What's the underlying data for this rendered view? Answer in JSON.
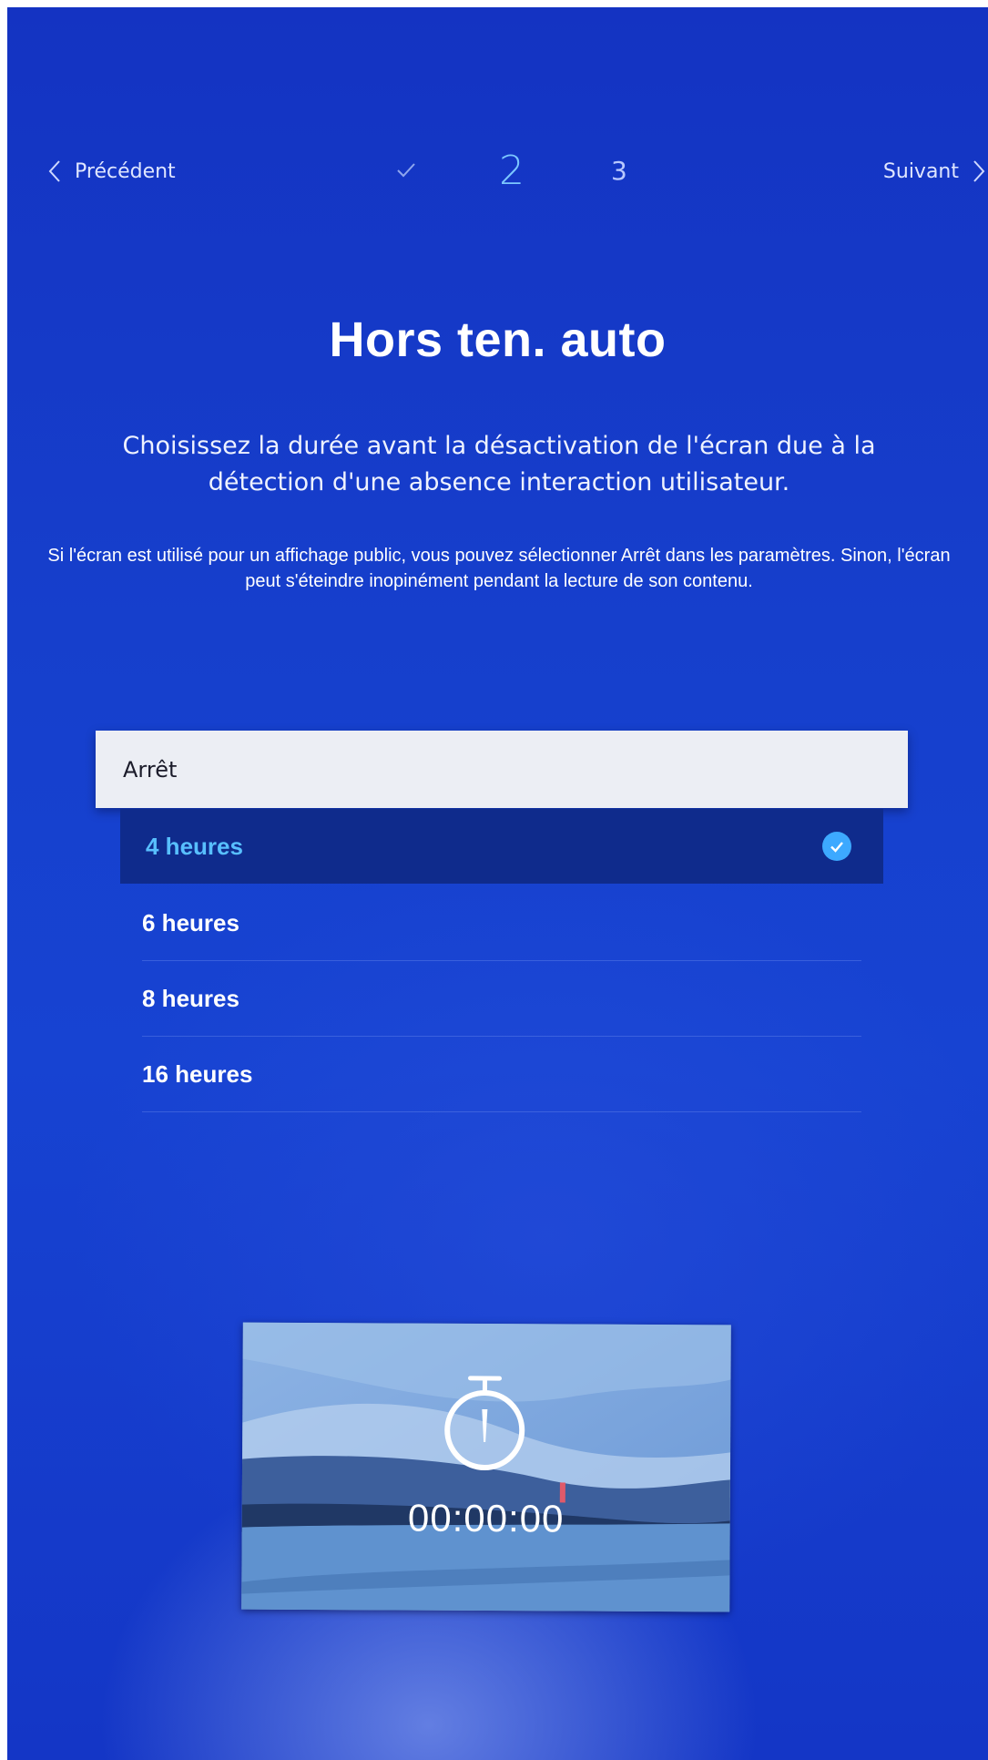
{
  "nav": {
    "previous_label": "Précédent",
    "next_label": "Suivant",
    "steps": {
      "done_icon": "check-icon",
      "current": "2",
      "next": "3"
    }
  },
  "title": "Hors ten. auto",
  "subtitle": "Choisissez la durée avant la désactivation de l'écran due à la détection d'une absence interaction utilisateur.",
  "note": "Si l'écran est utilisé pour un affichage public, vous pouvez sélectionner Arrêt dans les paramètres. Sinon, l'écran peut s'éteindre inopinément pendant la lecture de son contenu.",
  "options": [
    {
      "label": "Arrêt",
      "state": "focused"
    },
    {
      "label": "4 heures",
      "state": "selected"
    },
    {
      "label": "6 heures",
      "state": "normal"
    },
    {
      "label": "8 heures",
      "state": "normal"
    },
    {
      "label": "16 heures",
      "state": "normal"
    }
  ],
  "preview": {
    "timer": "00:00:00",
    "icon": "stopwatch-icon"
  },
  "colors": {
    "background": "#1743d2",
    "accent": "#58bfff",
    "check": "#3da9ff",
    "focus_bg": "#eceef4",
    "selected_bg": "#0f2b8c"
  }
}
